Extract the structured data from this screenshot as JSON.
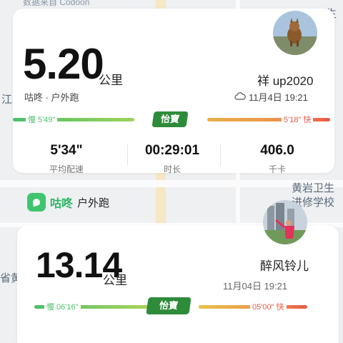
{
  "map": {
    "top_label": "数据来自 Codoon",
    "label_left_mid": "江",
    "label_left_bottom": "省黄",
    "label_right_top": "生",
    "label_right_mid_1": "黄岩卫生",
    "label_right_mid_2": "进修学校"
  },
  "card1": {
    "distance": "5.20",
    "unit": "公里",
    "subtitle": "咕咚 · 户外跑",
    "username": "祥 up2020",
    "datetime": "11月4日 19:21",
    "pace_slow": "慢 5'49\"",
    "pace_fast": "5'18\" 快",
    "logo": "怡寶",
    "stats": [
      {
        "value": "5'34\"",
        "label": "平均配速"
      },
      {
        "value": "00:29:01",
        "label": "时长"
      },
      {
        "value": "406.0",
        "label": "千卡"
      }
    ]
  },
  "brand": {
    "name": "咕咚",
    "type": "户外跑"
  },
  "card2": {
    "distance": "13.14",
    "unit": "公里",
    "username": "醉风铃儿",
    "datetime": "11月04日 19:21",
    "pace_slow": "慢 06'16\"",
    "pace_fast": "05'00\" 快",
    "logo": "怡寶"
  },
  "colors": {
    "green": "#4cc06a",
    "orange": "#ef8c4a",
    "red": "#e65a4a",
    "brand_green": "#2fb463"
  }
}
